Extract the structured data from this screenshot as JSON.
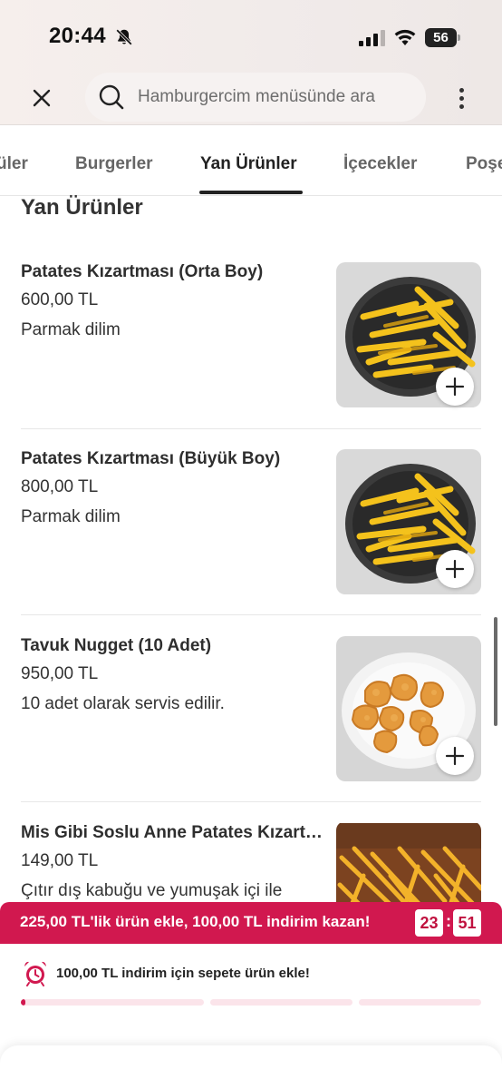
{
  "status_bar": {
    "time": "20:44",
    "battery": "56"
  },
  "search": {
    "placeholder": "Hamburgercim menüsünde ara"
  },
  "tabs": [
    {
      "label": "üler"
    },
    {
      "label": "Burgerler"
    },
    {
      "label": "Yan Ürünler",
      "active": true
    },
    {
      "label": "İçecekler"
    },
    {
      "label": "Poşe"
    }
  ],
  "section": {
    "title": "Yan Ürünler"
  },
  "items": [
    {
      "name": "Patates Kızartması (Orta Boy)",
      "price": "600,00 TL",
      "description": "Parmak dilim",
      "image": "fries-bowl-icon"
    },
    {
      "name": "Patates Kızartması (Büyük Boy)",
      "price": "800,00 TL",
      "description": "Parmak dilim",
      "image": "fries-bowl-icon"
    },
    {
      "name": "Tavuk Nugget (10 Adet)",
      "price": "950,00 TL",
      "description": "10 adet olarak servis edilir.",
      "image": "nuggets-plate-icon"
    },
    {
      "name": "Mis Gibi Soslu Anne Patates Kızartması",
      "price": "149,00 TL",
      "description": "Çıtır dış kabuğu ve yumuşak içi ile",
      "image": "fries-box-icon"
    }
  ],
  "promo": {
    "text": "225,00 TL'lik ürün ekle, 100,00 TL indirim kazan!",
    "timer_min": "23",
    "timer_sep": ":",
    "timer_sec": "51",
    "hint": "100,00 TL indirim için sepete ürün ekle!",
    "progress": 0.01
  },
  "colors": {
    "accent": "#d1184f",
    "accent_light": "#fbe4ea",
    "text": "#2e2e2e",
    "header_bg": "#f3edeb"
  }
}
